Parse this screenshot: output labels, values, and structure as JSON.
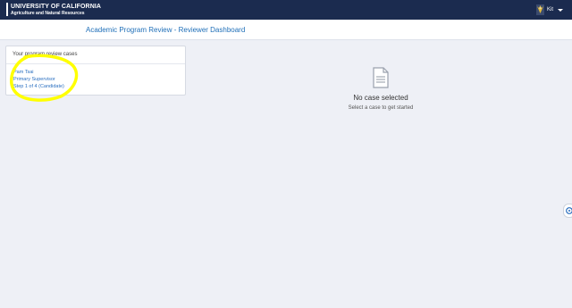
{
  "header": {
    "logo_line1": "UNIVERSITY OF CALIFORNIA",
    "logo_line2": "Agriculture and Natural Resources",
    "user_name": "Kit"
  },
  "page_title": "Academic Program Review - Reviewer Dashboard",
  "cases_panel": {
    "heading": "Your program review cases",
    "items": [
      {
        "name": "Pam Tsai",
        "role": "Primary Supervisor",
        "step": "Step 1 of 4 (Candidate)"
      }
    ]
  },
  "empty_state": {
    "title": "No case selected",
    "subtitle": "Select a case to get started"
  },
  "colors": {
    "topbar": "#1b2b4f",
    "link": "#1f6fb8",
    "highlight": "#ffff00"
  },
  "icons": [
    "user-avatar-icon",
    "chevron-down-icon",
    "document-icon",
    "accessibility-icon"
  ]
}
